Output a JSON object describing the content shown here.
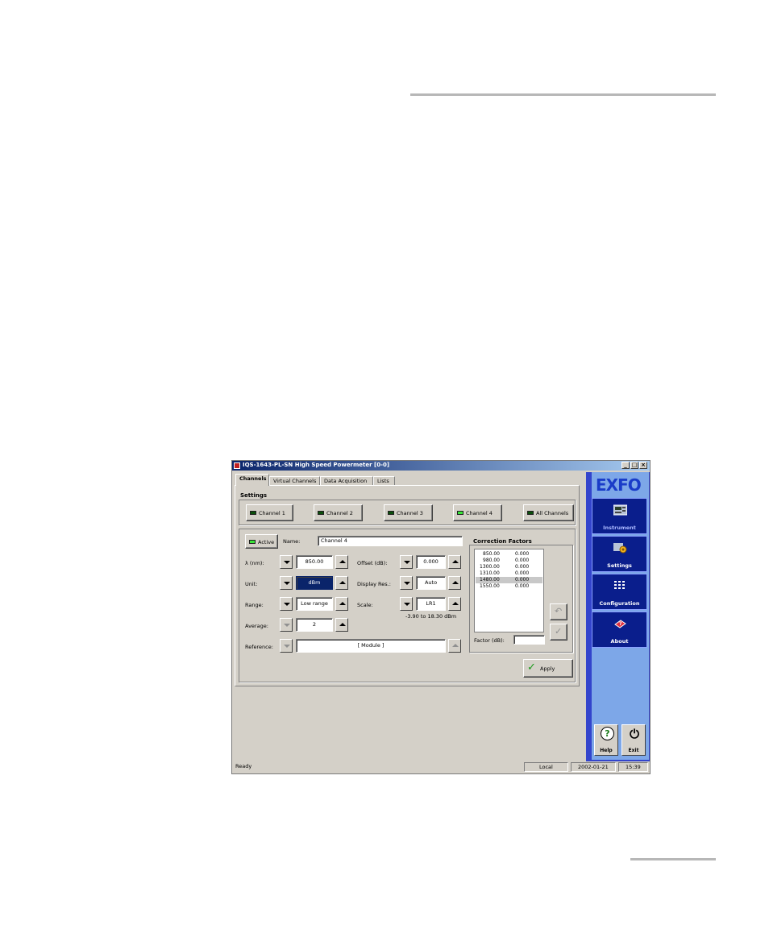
{
  "window": {
    "title": "IQS-1643-PL-SN High Speed Powermeter [0-0]",
    "controls": [
      "_",
      "□",
      "×"
    ]
  },
  "tabs": [
    {
      "label": "Channels",
      "active": true
    },
    {
      "label": "Virtual Channels",
      "active": false
    },
    {
      "label": "Data Acquisition",
      "active": false
    },
    {
      "label": "Lists",
      "active": false
    }
  ],
  "settings": {
    "title": "Settings",
    "channels": [
      {
        "label": "Channel 1",
        "led": "off"
      },
      {
        "label": "Channel 2",
        "led": "off"
      },
      {
        "label": "Channel 3",
        "led": "off"
      },
      {
        "label": "Channel 4",
        "led": "on"
      },
      {
        "label": "All Channels",
        "led": "off"
      }
    ]
  },
  "channel": {
    "active_label": "Active",
    "name_label": "Name:",
    "name_value": "Channel 4",
    "wavelength_label": "λ (nm):",
    "wavelength_value": "850.00",
    "unit_label": "Unit:",
    "unit_value": "dBm",
    "range_label": "Range:",
    "range_value": "Low range",
    "average_label": "Average:",
    "average_value": "2",
    "offset_label": "Offset (dB):",
    "offset_value": "0.000",
    "display_res_label": "Display Res.:",
    "display_res_value": "Auto",
    "scale_label": "Scale:",
    "scale_value": "LR1",
    "scale_range": "-3.90 to 18.30 dBm",
    "reference_label": "Reference:",
    "reference_value": "[ Module ]"
  },
  "correction": {
    "title": "Correction Factors",
    "rows": [
      {
        "wl": "850.00",
        "f": "0.000",
        "highlight": false
      },
      {
        "wl": "980.00",
        "f": "0.000",
        "highlight": false
      },
      {
        "wl": "1300.00",
        "f": "0.000",
        "highlight": false
      },
      {
        "wl": "1310.00",
        "f": "0.000",
        "highlight": false
      },
      {
        "wl": "1480.00",
        "f": "0.000",
        "highlight": true
      },
      {
        "wl": "1550.00",
        "f": "0.000",
        "highlight": false
      }
    ],
    "factor_label": "Factor (dB):",
    "factor_value": ""
  },
  "apply_label": "Apply",
  "sidebar": {
    "logo": "EXFO",
    "items": [
      {
        "label": "Instrument",
        "icon": "instrument-icon"
      },
      {
        "label": "Settings",
        "icon": "settings-icon"
      },
      {
        "label": "Configuration",
        "icon": "configuration-icon"
      },
      {
        "label": "About",
        "icon": "about-icon"
      }
    ],
    "help_label": "Help",
    "exit_label": "Exit"
  },
  "status": {
    "text": "Ready",
    "mode": "Local",
    "date": "2002-01-21",
    "time": "15:39"
  },
  "colors": {
    "led_on": "#39e639",
    "led_off": "#0b4f0b",
    "sidebar_blue": "#0a1e8c",
    "title_blue": "#0a246a"
  }
}
